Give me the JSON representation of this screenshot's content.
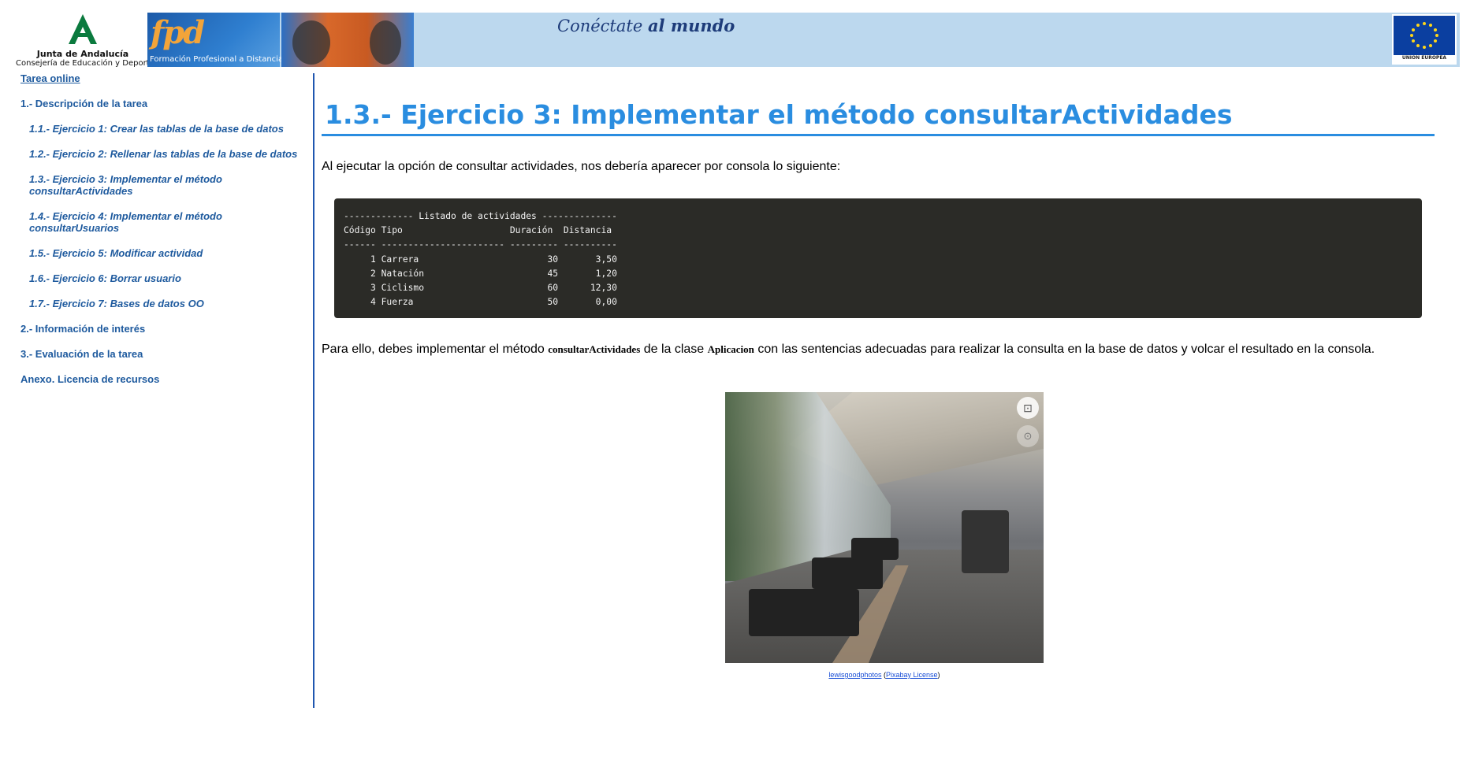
{
  "header": {
    "junta_name": "Junta de Andalucía",
    "junta_sub": "Consejería de Educación y Deporte",
    "fpd_logo": "fpd",
    "fpd_text": "Formación Profesional a Distancia",
    "slogan_a": "Conéctate",
    "slogan_b": "al mundo",
    "eu_label": "UNIÓN EUROPEA",
    "colors": {
      "banner": "#bcd8ee",
      "fpd": "#2f7fd0",
      "accent": "#2a8de0",
      "link": "#1e5a9e"
    }
  },
  "sidebar": {
    "top_link": "Tarea online",
    "items": [
      {
        "label": "1.- Descripción de la tarea",
        "level": 1
      },
      {
        "label": "1.1.- Ejercicio 1: Crear las tablas de la base de datos",
        "level": 2
      },
      {
        "label": "1.2.- Ejercicio 2: Rellenar las tablas de la base de datos",
        "level": 2
      },
      {
        "label": "1.3.- Ejercicio 3: Implementar el método consultarActividades",
        "level": 2
      },
      {
        "label": "1.4.- Ejercicio 4: Implementar el método consultarUsuarios",
        "level": 2
      },
      {
        "label": "1.5.- Ejercicio 5: Modificar actividad",
        "level": 2
      },
      {
        "label": "1.6.- Ejercicio 6: Borrar usuario",
        "level": 2
      },
      {
        "label": "1.7.- Ejercicio 7: Bases de datos OO",
        "level": 2
      },
      {
        "label": "2.- Información de interés",
        "level": 1
      },
      {
        "label": "3.- Evaluación de la tarea",
        "level": 1
      },
      {
        "label": "Anexo. Licencia de recursos",
        "level": 1
      }
    ]
  },
  "main": {
    "title": "1.3.- Ejercicio 3: Implementar el método consultarActividades",
    "intro": "Al ejecutar la opción de consultar actividades, nos debería aparecer por consola lo siguiente:",
    "console_lines": [
      "------------- Listado de actividades --------------",
      "Código Tipo                    Duración  Distancia",
      "------ ----------------------- --------- ----------",
      "     1 Carrera                        30       3,50",
      "     2 Natación                       45       1,20",
      "     3 Ciclismo                       60      12,30",
      "     4 Fuerza                         50       0,00"
    ],
    "para2_a": "Para ello, debes implementar el método ",
    "para2_code1": "consultarActividades",
    "para2_b": " de la clase ",
    "para2_code2": "Aplicacion",
    "para2_c": " con las sentencias adecuadas para realizar la consulta en la base de datos y volcar el resultado en la consola.",
    "figure": {
      "image_desc_icon": "gym-photo",
      "credit_author": "lewisgoodphotos",
      "credit_open": " (",
      "credit_license": "Pixabay License",
      "credit_close": ")"
    }
  }
}
